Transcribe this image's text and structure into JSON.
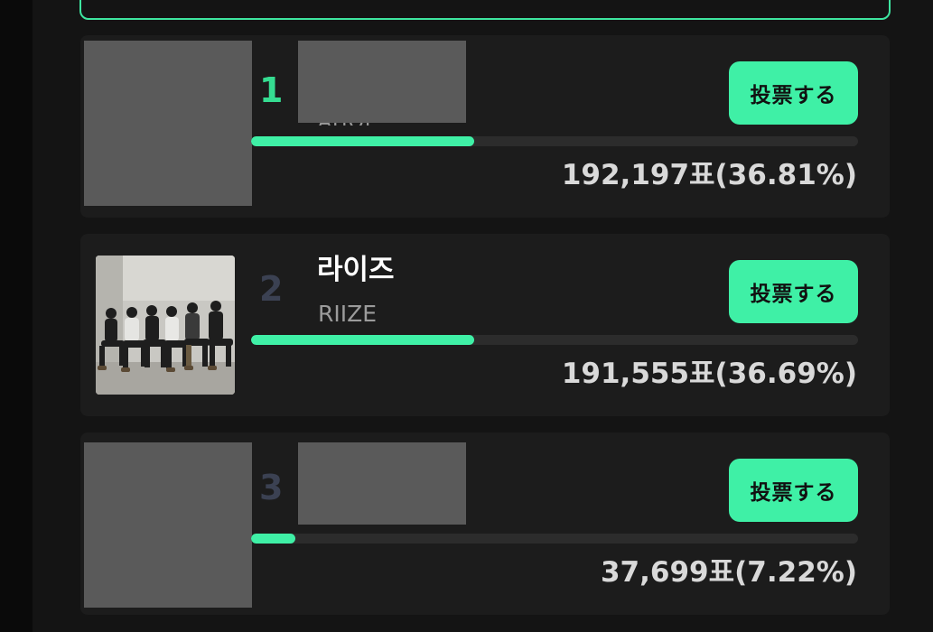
{
  "vote_button_label": "投票する",
  "colors": {
    "accent": "#3ff0a6",
    "rank_first": "#35dc91",
    "rank_other": "#3b4152",
    "card_bg": "#1c1c1c",
    "page_bg": "#141414"
  },
  "entries": [
    {
      "rank": "1",
      "name": "",
      "name_en": "AHOP",
      "votes_text": "192,197표(36.81%)",
      "percent": 36.81,
      "redacted": true
    },
    {
      "rank": "2",
      "name": "라이즈",
      "name_en": "RIIZE",
      "votes_text": "191,555표(36.69%)",
      "percent": 36.69,
      "redacted": false
    },
    {
      "rank": "3",
      "name": "",
      "name_en": "",
      "votes_text": "37,699표(7.22%)",
      "percent": 7.22,
      "redacted": true
    }
  ]
}
